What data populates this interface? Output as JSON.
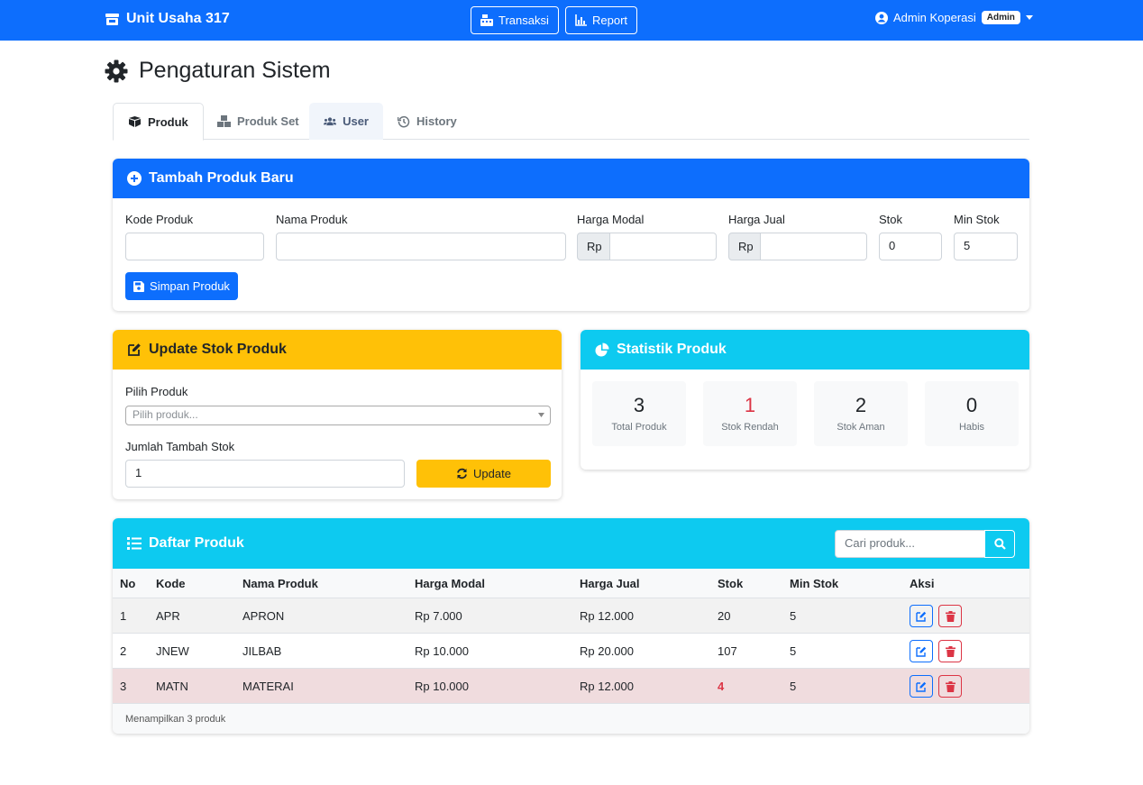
{
  "navbar": {
    "brand": "Unit Usaha 317",
    "transaksi_label": "Transaksi",
    "report_label": "Report",
    "user_name": "Admin Koperasi",
    "role_badge": "Admin"
  },
  "page_title": "Pengaturan Sistem",
  "tabs": [
    {
      "label": "Produk",
      "icon": "box-icon"
    },
    {
      "label": "Produk Set",
      "icon": "boxes-icon"
    },
    {
      "label": "User",
      "icon": "users-icon"
    },
    {
      "label": "History",
      "icon": "history-icon"
    }
  ],
  "add_product": {
    "title": "Tambah Produk Baru",
    "kode_label": "Kode Produk",
    "nama_label": "Nama Produk",
    "modal_label": "Harga Modal",
    "jual_label": "Harga Jual",
    "stok_label": "Stok",
    "min_stok_label": "Min Stok",
    "currency_prefix": "Rp",
    "stok_value": "0",
    "min_stok_value": "5",
    "save_label": "Simpan Produk"
  },
  "update_stock": {
    "title": "Update Stok Produk",
    "pilih_label": "Pilih Produk",
    "pilih_placeholder": "Pilih produk...",
    "jumlah_label": "Jumlah Tambah Stok",
    "jumlah_value": "1",
    "update_label": "Update"
  },
  "statistics": {
    "title": "Statistik Produk",
    "items": [
      {
        "value": "3",
        "label": "Total Produk"
      },
      {
        "value": "1",
        "label": "Stok Rendah"
      },
      {
        "value": "2",
        "label": "Stok Aman"
      },
      {
        "value": "0",
        "label": "Habis"
      }
    ]
  },
  "product_list": {
    "title": "Daftar Produk",
    "search_placeholder": "Cari produk...",
    "columns": [
      "No",
      "Kode",
      "Nama Produk",
      "Harga Modal",
      "Harga Jual",
      "Stok",
      "Min Stok",
      "Aksi"
    ],
    "rows": [
      {
        "no": "1",
        "kode": "APR",
        "nama": "APRON",
        "modal": "Rp 7.000",
        "jual": "Rp 12.000",
        "stok": "20",
        "min": "5"
      },
      {
        "no": "2",
        "kode": "JNEW",
        "nama": "JILBAB",
        "modal": "Rp 10.000",
        "jual": "Rp 20.000",
        "stok": "107",
        "min": "5"
      },
      {
        "no": "3",
        "kode": "MATN",
        "nama": "MATERAI",
        "modal": "Rp 10.000",
        "jual": "Rp 12.000",
        "stok": "4",
        "min": "5"
      }
    ],
    "footer": "Menampilkan 3 produk"
  },
  "colors": {
    "primary": "#0d6efd",
    "warning": "#ffc107",
    "info": "#0dcaf0",
    "danger": "#dc3545"
  }
}
